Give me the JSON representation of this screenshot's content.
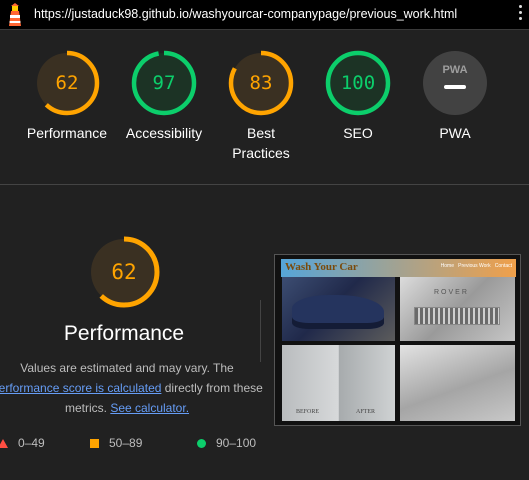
{
  "topbar": {
    "url": "https://justaduck98.github.io/washyourcar-companypage/previous_work.html",
    "logo_icon": "lighthouse-icon",
    "menu_icon": "more-vertical-icon"
  },
  "colors": {
    "average": "#ffa400",
    "pass": "#0cce6b",
    "fail": "#ff4e42",
    "neutral": "#9e9e9e",
    "link": "#669df6"
  },
  "summary": [
    {
      "score": "62",
      "label": "Performance",
      "status": "average"
    },
    {
      "score": "97",
      "label": "Accessibility",
      "status": "pass"
    },
    {
      "score": "83",
      "label": "Best Practices",
      "status": "average"
    },
    {
      "score": "100",
      "label": "SEO",
      "status": "pass"
    },
    {
      "score": "",
      "label": "PWA",
      "status": "neutral",
      "badge_text": "PWA"
    }
  ],
  "performance": {
    "score": "62",
    "title": "Performance",
    "note_line1": "Values are estimated and may vary. The",
    "note_link1": "performance score is calculated",
    "note_mid": " directly from these",
    "note_line3": "metrics. ",
    "note_link2": "See calculator."
  },
  "legend": [
    {
      "range": "0–49",
      "shape": "triangle"
    },
    {
      "range": "50–89",
      "shape": "square"
    },
    {
      "range": "90–100",
      "shape": "circle"
    }
  ],
  "screenshot": {
    "site_title": "Wash Your Car",
    "nav": [
      "Home",
      "Previous Work",
      "Contact"
    ],
    "brand": "ROVER",
    "captions": [
      "BEFORE",
      "AFTER"
    ]
  }
}
